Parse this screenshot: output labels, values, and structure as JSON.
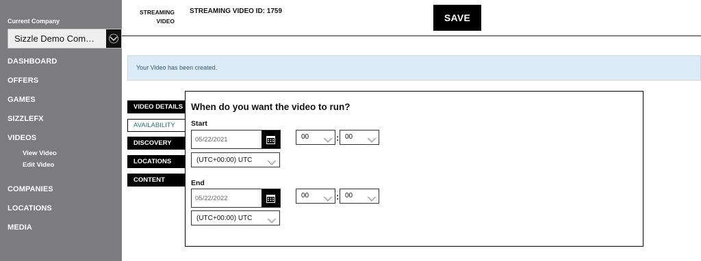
{
  "sidebar": {
    "company_caption": "Current Company",
    "company_value": "Sizzle Demo Com…",
    "nav": {
      "dashboard": "DASHBOARD",
      "offers": "OFFERS",
      "games": "GAMES",
      "sizzlefx": "SIZZLEFX",
      "videos": "VIDEOS",
      "view_video": "View Video",
      "edit_video": "Edit Video",
      "companies": "COMPANIES",
      "locations": "LOCATIONS",
      "media": "MEDIA"
    }
  },
  "header": {
    "caption_line1": "STREAMING",
    "caption_line2": "VIDEO",
    "id_label": "STREAMING VIDEO ID: 1759",
    "save_label": "SAVE"
  },
  "alert": {
    "message": "Your Video has been created."
  },
  "tabs": {
    "video_details": "VIDEO DETAILS",
    "availability": "AVAILABILITY",
    "discovery": "DISCOVERY",
    "locations": "LOCATIONS",
    "content": "CONTENT",
    "active": "availability"
  },
  "availability": {
    "title": "When do you want the video to run?",
    "start": {
      "label": "Start",
      "date": "05/22/2021",
      "timezone": "(UTC+00:00) UTC",
      "hour": "00",
      "minute": "00"
    },
    "end": {
      "label": "End",
      "date": "05/22/2022",
      "timezone": "(UTC+00:00) UTC",
      "hour": "00",
      "minute": "00"
    },
    "time_separator": ":"
  },
  "icons": {
    "select_chevron": "chevron-down-icon",
    "calendar": "calendar-icon"
  },
  "colors": {
    "sidebar_bg": "#7c7b80",
    "alert_bg": "#dcebf6",
    "alert_text": "#345a78",
    "active_tab_text": "#2a6d6d",
    "primary_button": "#000000"
  }
}
